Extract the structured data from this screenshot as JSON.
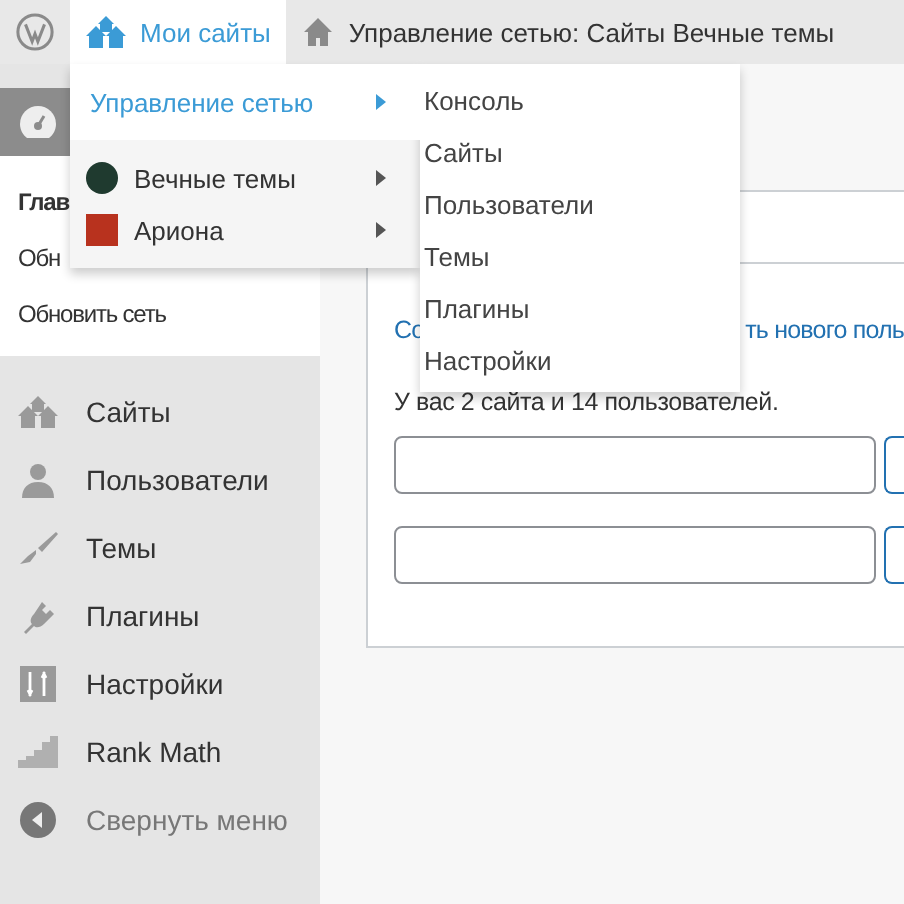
{
  "top_bar": {
    "items": [
      {
        "kind": "logo",
        "selected": false
      },
      {
        "kind": "sites",
        "label": "Мои сайты",
        "selected": true
      },
      {
        "kind": "home",
        "label": "Управление сетью: Сайты Вечные темы",
        "selected": false
      }
    ]
  },
  "sidebar": {
    "menu": [
      {
        "kind": "dashboard",
        "selected": true,
        "children": [
          {
            "label": "Глав",
            "selected": true
          },
          {
            "label": "Обн",
            "selected": false
          },
          {
            "label": "Обновить сеть",
            "selected": false
          }
        ]
      },
      {
        "kind": "sites",
        "label": "Сайты",
        "selected": false
      },
      {
        "kind": "users",
        "label": "Пользователи",
        "selected": false
      },
      {
        "kind": "themes",
        "label": "Темы",
        "selected": false
      },
      {
        "kind": "plugins",
        "label": "Плагины",
        "selected": false
      },
      {
        "kind": "settings",
        "label": "Настройки",
        "selected": false
      },
      {
        "kind": "chart",
        "label": "Rank Math",
        "selected": false
      },
      {
        "kind": "collapse",
        "label": "Свернуть меню",
        "selected": false
      }
    ]
  },
  "main": {
    "links": [
      "Со",
      "ть нового поль"
    ],
    "summary": "У вас 2 сайта и 14 пользователей.",
    "fields": [
      {
        "kind": "search"
      },
      {
        "kind": "search"
      }
    ]
  },
  "sites_menu": {
    "items": [
      {
        "kind": "network",
        "label": "Управление сетью",
        "selected": true
      },
      {
        "kind": "site",
        "label": "Вечные темы",
        "selected": false,
        "color": "#1f3a2f"
      },
      {
        "kind": "site",
        "label": "Ариона",
        "selected": false,
        "color": "#b8321e"
      }
    ],
    "submenu": [
      "Консоль",
      "Сайты",
      "Пользователи",
      "Темы",
      "Плагины",
      "Настройки"
    ]
  }
}
